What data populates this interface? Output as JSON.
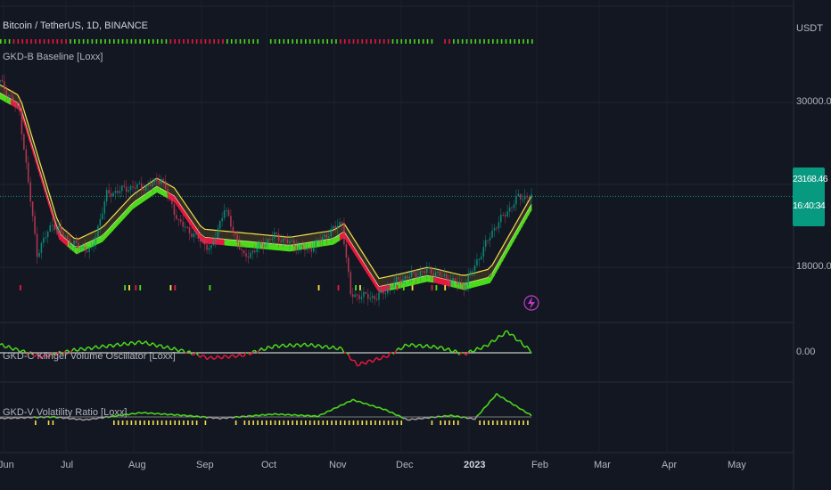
{
  "header": {
    "symbol_title": "Bitcoin / TetherUS, 1D, BINANCE",
    "currency": "USDT"
  },
  "panes": {
    "main_label": "GKD-B Baseline [Loxx]",
    "osc_label": "GKD-C Klinger Volume Oscillator [Loxx]",
    "vol_label": "GKD-V Volatility Ratio [Loxx]"
  },
  "price_axis": {
    "tick_30000": "30000.00",
    "tick_18000": "18000.00",
    "tick_osc_zero": "0.00"
  },
  "last_price": {
    "value": "23168.46",
    "countdown": "16:40:34",
    "color": "#089981"
  },
  "time_axis": {
    "labels": [
      "Jun",
      "Jul",
      "Aug",
      "Sep",
      "Oct",
      "Nov",
      "Dec",
      "2023",
      "Feb",
      "Mar",
      "Apr",
      "May"
    ]
  },
  "colors": {
    "background": "#131722",
    "bull": "#4cdb1b",
    "bear": "#e8173f",
    "baseline_edge": "#f4e04d",
    "neutral": "#9a9a9a",
    "signal": "#f4e04d"
  },
  "chart_data": [
    {
      "type": "line",
      "title": "Bitcoin / TetherUS, 1D, BINANCE",
      "x_start": "2022-06-01",
      "x_end": "2023-01-31",
      "price_series": [
        {
          "date": "2022-06-01",
          "price": 31500
        },
        {
          "date": "2022-06-10",
          "price": 29300
        },
        {
          "date": "2022-06-18",
          "price": 19000
        },
        {
          "date": "2022-06-25",
          "price": 21200
        },
        {
          "date": "2022-07-04",
          "price": 19700
        },
        {
          "date": "2022-07-13",
          "price": 19200
        },
        {
          "date": "2022-07-20",
          "price": 23300
        },
        {
          "date": "2022-07-30",
          "price": 23800
        },
        {
          "date": "2022-08-08",
          "price": 23900
        },
        {
          "date": "2022-08-14",
          "price": 24500
        },
        {
          "date": "2022-08-22",
          "price": 21300
        },
        {
          "date": "2022-09-06",
          "price": 19300
        },
        {
          "date": "2022-09-12",
          "price": 22300
        },
        {
          "date": "2022-09-21",
          "price": 18700
        },
        {
          "date": "2022-10-05",
          "price": 20300
        },
        {
          "date": "2022-10-20",
          "price": 19200
        },
        {
          "date": "2022-11-05",
          "price": 21300
        },
        {
          "date": "2022-11-09",
          "price": 16000
        },
        {
          "date": "2022-11-21",
          "price": 15800
        },
        {
          "date": "2022-12-01",
          "price": 17100
        },
        {
          "date": "2022-12-15",
          "price": 17800
        },
        {
          "date": "2022-12-31",
          "price": 16600
        },
        {
          "date": "2023-01-14",
          "price": 20900
        },
        {
          "date": "2023-01-25",
          "price": 23100
        },
        {
          "date": "2023-01-31",
          "price": 23168.46
        }
      ],
      "baseline_series": [
        {
          "date": "2022-06-01",
          "value": 30700,
          "trend": "bull"
        },
        {
          "date": "2022-06-10",
          "value": 29900,
          "trend": "bear"
        },
        {
          "date": "2022-06-28",
          "value": 20500,
          "trend": "bear"
        },
        {
          "date": "2022-07-06",
          "value": 19400,
          "trend": "bull"
        },
        {
          "date": "2022-07-18",
          "value": 20300,
          "trend": "bull"
        },
        {
          "date": "2022-08-01",
          "value": 22700,
          "trend": "bull"
        },
        {
          "date": "2022-08-12",
          "value": 23900,
          "trend": "bull"
        },
        {
          "date": "2022-08-20",
          "value": 23200,
          "trend": "bear"
        },
        {
          "date": "2022-09-02",
          "value": 20200,
          "trend": "bear"
        },
        {
          "date": "2022-09-22",
          "value": 19900,
          "trend": "bull"
        },
        {
          "date": "2022-10-12",
          "value": 19600,
          "trend": "bull"
        },
        {
          "date": "2022-11-01",
          "value": 20100,
          "trend": "bull"
        },
        {
          "date": "2022-11-06",
          "value": 20600,
          "trend": "bear"
        },
        {
          "date": "2022-11-22",
          "value": 16600,
          "trend": "bear"
        },
        {
          "date": "2022-12-01",
          "value": 16900,
          "trend": "bull"
        },
        {
          "date": "2022-12-14",
          "value": 17400,
          "trend": "bull"
        },
        {
          "date": "2022-12-18",
          "value": 17300,
          "trend": "bear"
        },
        {
          "date": "2022-12-31",
          "value": 16800,
          "trend": "bull"
        },
        {
          "date": "2023-01-12",
          "value": 17300,
          "trend": "bull"
        },
        {
          "date": "2023-01-31",
          "value": 22600,
          "trend": "bull"
        }
      ],
      "ylim": [
        14500,
        34000
      ],
      "y_ticks": [
        30000,
        18000
      ],
      "grid": true
    },
    {
      "type": "line",
      "title": "GKD-C Klinger Volume Oscillator [Loxx]",
      "series": [
        {
          "date": "2022-06-01",
          "value": 0.6
        },
        {
          "date": "2022-06-20",
          "value": -0.3
        },
        {
          "date": "2022-07-05",
          "value": 0.2
        },
        {
          "date": "2022-07-20",
          "value": 0.5
        },
        {
          "date": "2022-08-05",
          "value": 0.8
        },
        {
          "date": "2022-08-25",
          "value": 0.1
        },
        {
          "date": "2022-09-05",
          "value": -0.4
        },
        {
          "date": "2022-09-20",
          "value": -0.2
        },
        {
          "date": "2022-10-05",
          "value": 0.5
        },
        {
          "date": "2022-10-20",
          "value": 0.6
        },
        {
          "date": "2022-11-05",
          "value": 0.3
        },
        {
          "date": "2022-11-12",
          "value": -0.9
        },
        {
          "date": "2022-11-25",
          "value": -0.3
        },
        {
          "date": "2022-12-05",
          "value": 0.6
        },
        {
          "date": "2022-12-20",
          "value": 0.4
        },
        {
          "date": "2022-12-31",
          "value": -0.1
        },
        {
          "date": "2023-01-10",
          "value": 0.5
        },
        {
          "date": "2023-01-20",
          "value": 1.6
        },
        {
          "date": "2023-01-31",
          "value": 0.1
        }
      ],
      "zero_line": 0
    },
    {
      "type": "line",
      "title": "GKD-V Volatility Ratio [Loxx]",
      "series": [
        {
          "date": "2022-06-01",
          "value": 0.9
        },
        {
          "date": "2022-06-25",
          "value": 1.0
        },
        {
          "date": "2022-07-10",
          "value": 0.8
        },
        {
          "date": "2022-08-05",
          "value": 1.3
        },
        {
          "date": "2022-08-25",
          "value": 1.1
        },
        {
          "date": "2022-09-10",
          "value": 0.9
        },
        {
          "date": "2022-10-05",
          "value": 1.2
        },
        {
          "date": "2022-10-25",
          "value": 1.05
        },
        {
          "date": "2022-11-10",
          "value": 2.2
        },
        {
          "date": "2022-11-25",
          "value": 1.5
        },
        {
          "date": "2022-12-05",
          "value": 0.8
        },
        {
          "date": "2022-12-25",
          "value": 1.1
        },
        {
          "date": "2023-01-05",
          "value": 0.85
        },
        {
          "date": "2023-01-15",
          "value": 2.6
        },
        {
          "date": "2023-01-31",
          "value": 1.1
        }
      ],
      "threshold": 1.0
    }
  ]
}
